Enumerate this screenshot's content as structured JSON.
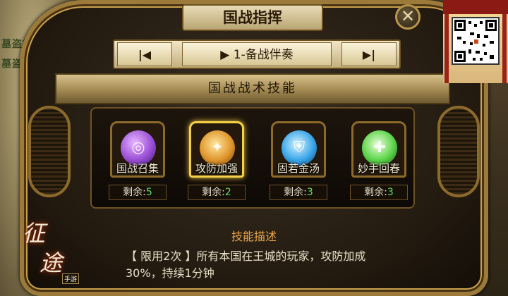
{
  "background": {
    "left_texts": [
      "墓盗神",
      "墓盗神"
    ]
  },
  "window": {
    "title": "国战指挥",
    "close_glyph": "✕"
  },
  "nav": {
    "prev_glyph": "|◀",
    "current": "▶ 1-备战伴奏",
    "next_glyph": "▶|"
  },
  "section": {
    "title": "国战战术技能"
  },
  "skills": [
    {
      "name": "国战召集",
      "remaining_label": "剩余:",
      "remaining": "5",
      "orb_color": "#9b4fd6",
      "icon": "summon-icon"
    },
    {
      "name": "攻防加强",
      "remaining_label": "剩余:",
      "remaining": "2",
      "orb_color": "#e0962c",
      "icon": "attack-defense-icon",
      "selected": true
    },
    {
      "name": "固若金汤",
      "remaining_label": "剩余:",
      "remaining": "3",
      "orb_color": "#3aa6e8",
      "icon": "shield-icon"
    },
    {
      "name": "妙手回春",
      "remaining_label": "剩余:",
      "remaining": "3",
      "orb_color": "#5cd44a",
      "icon": "heal-icon"
    }
  ],
  "description": {
    "title": "技能描述",
    "text": "【 限用2次 】所有本国在王城的玩家，攻防加成30%，持续1分钟"
  },
  "logo": {
    "chars": [
      "征",
      "途"
    ],
    "sub": "手游"
  },
  "colors": {
    "accent_gold": "#c9a14e",
    "remaining_number": "#5ee05e",
    "description_title": "#e9a64c"
  }
}
